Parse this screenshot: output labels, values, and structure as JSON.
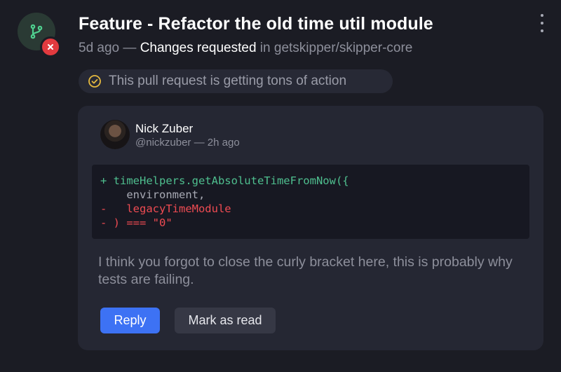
{
  "notification": {
    "title": "Feature - Refactor the old time util module",
    "meta": {
      "time": "5d ago",
      "separator": " — ",
      "status": "Changes requested",
      "in_text": " in ",
      "repo": "getskipper/skipper-core"
    },
    "icons": {
      "repo": "git-branch-icon",
      "status": "close-icon",
      "more": "more-vertical-icon",
      "activity": "check-circle-icon"
    },
    "activity_text": "This pull request is getting tons of action"
  },
  "comment": {
    "author_name": "Nick Zuber",
    "author_handle": "@nickzuber",
    "time_separator": " — ",
    "time": "2h ago",
    "code_lines": [
      {
        "type": "add",
        "text": "+ timeHelpers.getAbsoluteTimeFromNow({"
      },
      {
        "type": "ctx",
        "text": "    environment,"
      },
      {
        "type": "del",
        "text": "-   legacyTimeModule"
      },
      {
        "type": "del",
        "text": "- ) === \"0\""
      }
    ],
    "body": "I think you forgot to close the curly bracket here, this is probably why tests are failing."
  },
  "actions": {
    "reply_label": "Reply",
    "mark_read_label": "Mark as read"
  },
  "colors": {
    "background": "#1b1c24",
    "card": "#252733",
    "accent": "#3d72f4",
    "danger": "#e23a3f",
    "success": "#4fbf8f"
  }
}
